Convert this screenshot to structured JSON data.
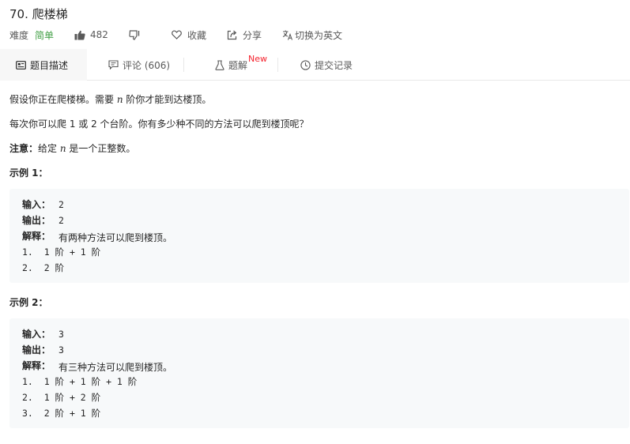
{
  "problem": {
    "title": "70. 爬楼梯",
    "difficulty_label": "难度",
    "difficulty_value": "简单",
    "likes": "482",
    "favorite_label": "收藏",
    "share_label": "分享",
    "translate_label": "切换为英文"
  },
  "tabs": {
    "description": "题目描述",
    "comments": "评论 (606)",
    "solutions": "题解",
    "solutions_badge": "New",
    "submissions": "提交记录"
  },
  "description": {
    "line1_pre": "假设你正在爬楼梯。需要 ",
    "line1_var": "n",
    "line1_post": " 阶你才能到达楼顶。",
    "line2": "每次你可以爬 1 或 2 个台阶。你有多少种不同的方法可以爬到楼顶呢？",
    "note_label": "注意：",
    "note_pre": "给定 ",
    "note_var": "n",
    "note_post": " 是一个正整数。"
  },
  "examples": [
    {
      "heading": "示例 1：",
      "input_label": "输入：",
      "input_value": "2",
      "output_label": "输出：",
      "output_value": "2",
      "explain_label": "解释：",
      "explain_value": "有两种方法可以爬到楼顶。",
      "steps": [
        "1.  1 阶 + 1 阶",
        "2.  2 阶"
      ]
    },
    {
      "heading": "示例 2：",
      "input_label": "输入：",
      "input_value": "3",
      "output_label": "输出：",
      "output_value": "3",
      "explain_label": "解释：",
      "explain_value": "有三种方法可以爬到楼顶。",
      "steps": [
        "1.  1 阶 + 1 阶 + 1 阶",
        "2.  1 阶 + 2 阶",
        "3.  2 阶 + 1 阶"
      ]
    }
  ],
  "colors": {
    "easy": "#43a047",
    "new_badge": "#f5222d",
    "code_bg": "#f7f9fa",
    "active_tab_bg": "#f7f7f7"
  },
  "icons": {
    "like": "thumbs-up-icon",
    "dislike": "thumbs-down-icon",
    "favorite": "heart-icon",
    "share": "share-icon",
    "translate": "translate-icon",
    "description": "document-icon",
    "comments": "comment-icon",
    "solutions": "flask-icon",
    "submissions": "clock-icon"
  }
}
